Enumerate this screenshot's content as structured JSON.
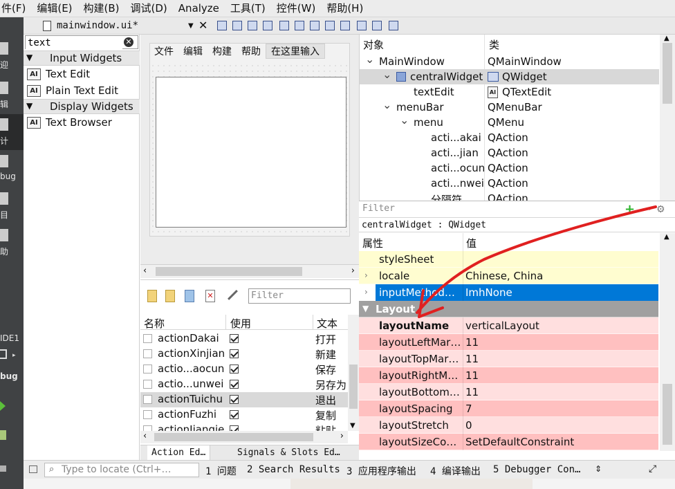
{
  "menubar": [
    "件(F)",
    "编辑(E)",
    "构建(B)",
    "调试(D)",
    "Analyze",
    "工具(T)",
    "控件(W)",
    "帮助(H)"
  ],
  "modes": [
    {
      "label": "迎",
      "icon": "welcome-icon"
    },
    {
      "label": "辑",
      "icon": "edit-icon"
    },
    {
      "label": "计",
      "icon": "design-icon"
    },
    {
      "label": "bug",
      "icon": "debug-icon"
    },
    {
      "label": "目",
      "icon": "projects-icon"
    },
    {
      "label": "助",
      "icon": "help-icon"
    }
  ],
  "kit": {
    "name": "IDE1",
    "build": "bug"
  },
  "tabbar": {
    "doc_title": "mainwindow.ui*",
    "close": "✕"
  },
  "widgetbox": {
    "search_value": "text",
    "categories": [
      {
        "name": "Input Widgets",
        "items": [
          "Text Edit",
          "Plain Text Edit"
        ]
      },
      {
        "name": "Display Widgets",
        "items": [
          "Text Browser"
        ]
      }
    ]
  },
  "form": {
    "menus": [
      "文件",
      "编辑",
      "构建",
      "帮助"
    ],
    "input_placeholder": "在这里输入"
  },
  "action_editor": {
    "filter_placeholder": "Filter",
    "headers": {
      "name": "名称",
      "used": "使用",
      "text": "文本"
    },
    "rows": [
      {
        "name": "actionDakai",
        "text": "打开",
        "used": true,
        "selected": false
      },
      {
        "name": "actionXinjian",
        "text": "新建",
        "used": true,
        "selected": false
      },
      {
        "name": "actio...aocun",
        "text": "保存",
        "used": true,
        "selected": false
      },
      {
        "name": "actio...unwei",
        "text": "另存为",
        "used": true,
        "selected": false
      },
      {
        "name": "actionTuichu",
        "text": "退出",
        "used": true,
        "selected": true
      },
      {
        "name": "actionFuzhi",
        "text": "复制",
        "used": true,
        "selected": false
      },
      {
        "name": "actionJianqie",
        "text": "粘贴",
        "used": true,
        "selected": false
      }
    ],
    "tabs": [
      "Action Ed…",
      "Signals & Slots Ed…"
    ]
  },
  "object_inspector": {
    "headers": {
      "object": "对象",
      "class": "类"
    },
    "rows": [
      {
        "object": "MainWindow",
        "class": "QMainWindow",
        "indent": 0,
        "expanded": true,
        "selected": false
      },
      {
        "object": "centralWidget",
        "class": "QWidget",
        "indent": 1,
        "expanded": true,
        "selected": true
      },
      {
        "object": "textEdit",
        "class": "QTextEdit",
        "indent": 2,
        "expanded": null,
        "selected": false
      },
      {
        "object": "menuBar",
        "class": "QMenuBar",
        "indent": 1,
        "expanded": true,
        "selected": false
      },
      {
        "object": "menu",
        "class": "QMenu",
        "indent": 2,
        "expanded": true,
        "selected": false
      },
      {
        "object": "acti...akai",
        "class": "QAction",
        "indent": 3,
        "expanded": null,
        "selected": false
      },
      {
        "object": "acti...jian",
        "class": "QAction",
        "indent": 3,
        "expanded": null,
        "selected": false
      },
      {
        "object": "acti...ocun",
        "class": "QAction",
        "indent": 3,
        "expanded": null,
        "selected": false
      },
      {
        "object": "acti...nwei",
        "class": "QAction",
        "indent": 3,
        "expanded": null,
        "selected": false
      },
      {
        "object": "分隔符",
        "class": "QAction",
        "indent": 3,
        "expanded": null,
        "selected": false
      }
    ]
  },
  "property_editor": {
    "filter_placeholder": "Filter",
    "context": "centralWidget : QWidget",
    "headers": {
      "property": "属性",
      "value": "值"
    },
    "rows": [
      {
        "name": "styleSheet",
        "value": "",
        "kind": "yellow",
        "expandable": false,
        "bold": false
      },
      {
        "name": "locale",
        "value": "Chinese, China",
        "kind": "yellow",
        "expandable": true,
        "bold": false
      },
      {
        "name": "inputMethod…",
        "value": "ImhNone",
        "kind": "selected",
        "expandable": true,
        "bold": false
      },
      {
        "name": "Layout",
        "value": "",
        "kind": "group",
        "expandable": true,
        "bold": true
      },
      {
        "name": "layoutName",
        "value": "verticalLayout",
        "kind": "pink-light",
        "expandable": false,
        "bold": true
      },
      {
        "name": "layoutLeftMar…",
        "value": "11",
        "kind": "pink",
        "expandable": false,
        "bold": false
      },
      {
        "name": "layoutTopMar…",
        "value": "11",
        "kind": "pink-light",
        "expandable": false,
        "bold": false
      },
      {
        "name": "layoutRightM…",
        "value": "11",
        "kind": "pink",
        "expandable": false,
        "bold": false
      },
      {
        "name": "layoutBottom…",
        "value": "11",
        "kind": "pink-light",
        "expandable": false,
        "bold": false
      },
      {
        "name": "layoutSpacing",
        "value": "7",
        "kind": "pink",
        "expandable": false,
        "bold": false
      },
      {
        "name": "layoutStretch",
        "value": "0",
        "kind": "pink-light",
        "expandable": false,
        "bold": false
      },
      {
        "name": "layoutSizeCon…",
        "value": "SetDefaultConstraint",
        "kind": "pink",
        "expandable": false,
        "bold": false
      }
    ]
  },
  "statusbar": {
    "locate_placeholder": "Type to locate (Ctrl+…",
    "items": [
      "1 问题",
      "2 Search Results",
      "3 应用程序输出",
      "4 编译输出",
      "5 Debugger Con…"
    ]
  },
  "colors": {
    "selection_blue": "#0078d7",
    "row_yellow": "#fffdd0",
    "row_pink": "#ffc0c0",
    "row_pink_light": "#ffdfdf",
    "group_gray": "#a0a0a0",
    "annotation_red": "#e02020"
  }
}
